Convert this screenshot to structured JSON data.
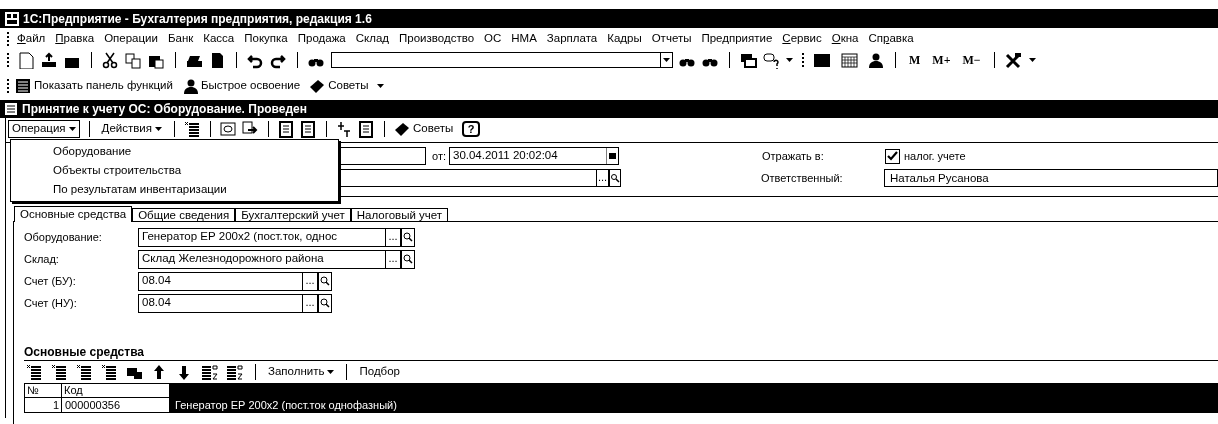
{
  "app_title": "1С:Предприятие - Бухгалтерия предприятия, редакция 1.6",
  "menu_bar": [
    {
      "key": "Ф",
      "post": "айл"
    },
    {
      "key": "П",
      "post": "равка"
    },
    {
      "pre": "Операции"
    },
    {
      "pre": "Банк"
    },
    {
      "pre": "Касса"
    },
    {
      "pre": "Покупка"
    },
    {
      "pre": "Продажа"
    },
    {
      "pre": "Склад"
    },
    {
      "pre": "Производство"
    },
    {
      "pre": "ОС"
    },
    {
      "pre": "НМА"
    },
    {
      "pre": "Зарплата"
    },
    {
      "pre": "Кадры"
    },
    {
      "pre": "Отчеты"
    },
    {
      "pre": "Предприятие"
    },
    {
      "key": "С",
      "post": "ервис"
    },
    {
      "key": "О",
      "post": "кна"
    },
    {
      "pre": "Сп",
      "key": "р",
      "post": "авка"
    }
  ],
  "memory_buttons": [
    "M",
    "M+",
    "M−"
  ],
  "quick_toolbar": [
    "Показать панель функций",
    "Быстрое освоение",
    "Советы"
  ],
  "doc_title": "Принятие к учету ОС: Оборудование. Проведен",
  "doc_toolbar": {
    "operation": "Операция",
    "actions": "Действия",
    "tips": "Советы",
    "help": "?"
  },
  "dropdown_menu": [
    "Оборудование",
    "Объекты строительства",
    "По результатам инвентаризации"
  ],
  "header": {
    "date_label": "от:",
    "date": "30.04.2011 20:02:04",
    "reflect_label": "Отражать в:",
    "tax_checkbox": {
      "label": "налог. учете",
      "checked": true
    },
    "responsible_label": "Ответственный:",
    "responsible": "Наталья Русанова",
    "organization_browse": "..."
  },
  "tabs": [
    {
      "label": "Основные средства",
      "selected": true
    },
    {
      "label": "Общие сведения",
      "selected": false
    },
    {
      "label": "Бухгалтерский учет",
      "selected": false
    },
    {
      "label": "Налоговый учет",
      "selected": false
    }
  ],
  "fields": [
    {
      "label": "Оборудование:",
      "value": "Генератор ЕР 200х2 (пост.ток, однос",
      "browse": "..."
    },
    {
      "label": "Склад:",
      "value": "Склад Железнодорожного района",
      "browse": "..."
    },
    {
      "label": "Счет (БУ):",
      "value": "08.04",
      "browse": "..."
    },
    {
      "label": "Счет (НУ):",
      "value": "08.04",
      "browse": "..."
    }
  ],
  "section_title": "Основные средства",
  "table_toolbar": {
    "fill": "Заполнить",
    "pick": "Подбор"
  },
  "table": {
    "columns": [
      "№",
      "Код"
    ],
    "rows": [
      {
        "number": "1",
        "code": "000000356",
        "column_3": "Генератор ЕР 200х2 (пост.ток однофазный)",
        "selected": true
      }
    ]
  }
}
